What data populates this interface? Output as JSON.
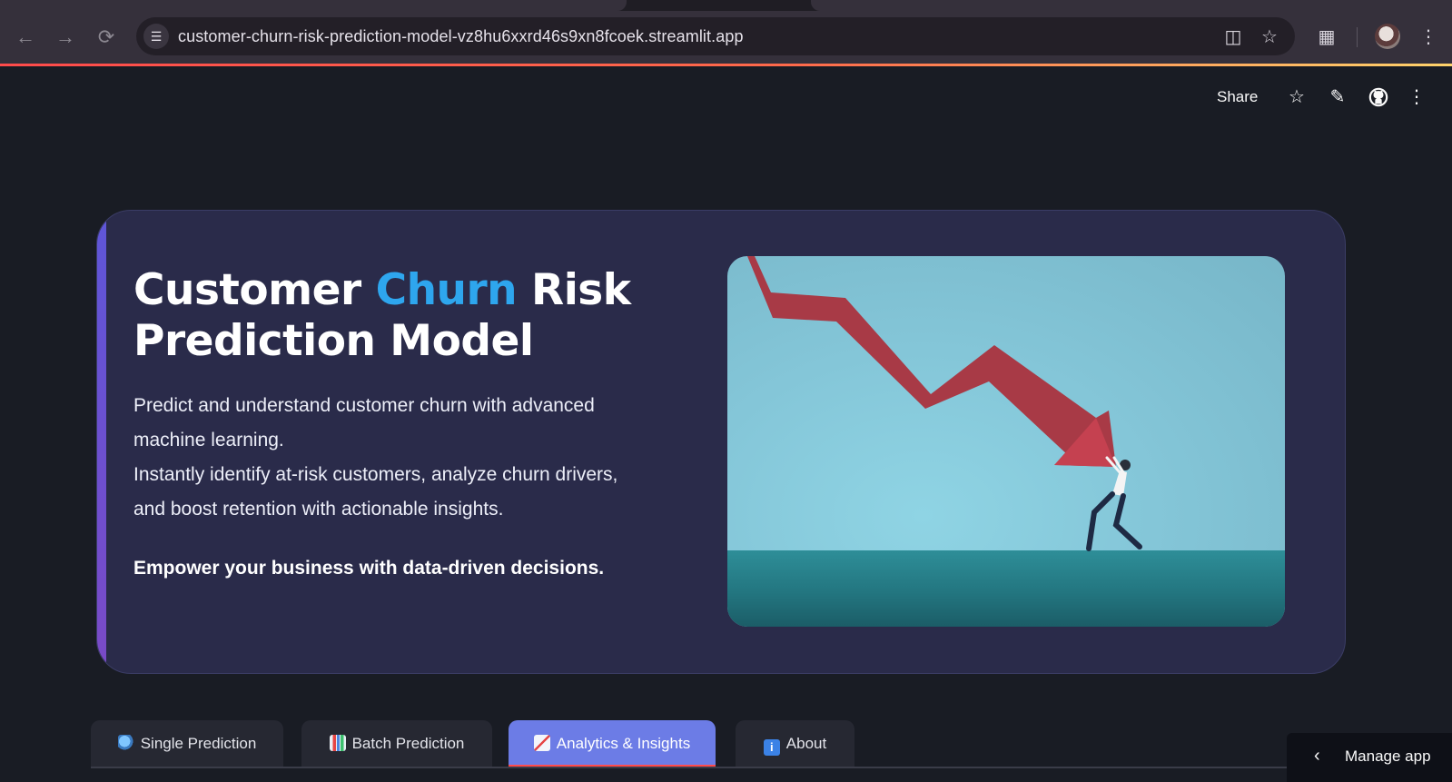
{
  "browser": {
    "url": "customer-churn-risk-prediction-model-vz8hu6xxrd46s9xn8fcoek.streamlit.app",
    "icons": {
      "back": "arrow-left-icon",
      "forward": "arrow-right-icon",
      "reload": "reload-icon",
      "site_info": "tune-icon",
      "install": "install-app-icon",
      "bookmark": "star-icon",
      "extensions": "puzzle-icon",
      "profile": "avatar",
      "menu": "kebab-icon"
    }
  },
  "header": {
    "share_label": "Share",
    "icons": [
      "star-icon",
      "pencil-icon",
      "github-icon",
      "kebab-icon"
    ]
  },
  "hero": {
    "title_part1": "Customer ",
    "title_highlight": "Churn",
    "title_part2": " Risk",
    "title_line2": "Prediction Model",
    "description_line1": "Predict and understand customer churn with advanced machine learning.",
    "description_line2": "Instantly identify at-risk customers, analyze churn drivers, and boost retention with actionable insights.",
    "cta": "Empower your business with data-driven decisions.",
    "colors": {
      "highlight": "#2ea6ee",
      "card_bg": "#2a2b4a",
      "accent_bar": "#5e56d8"
    }
  },
  "tabs": [
    {
      "label": "Single Prediction",
      "icon": "magnifier-icon",
      "active": false
    },
    {
      "label": "Batch Prediction",
      "icon": "bar-chart-icon",
      "active": false
    },
    {
      "label": "Analytics & Insights",
      "icon": "trend-chart-icon",
      "active": true
    },
    {
      "label": "About",
      "icon": "info-icon",
      "active": false
    }
  ],
  "manage_app": {
    "label": "Manage app"
  }
}
